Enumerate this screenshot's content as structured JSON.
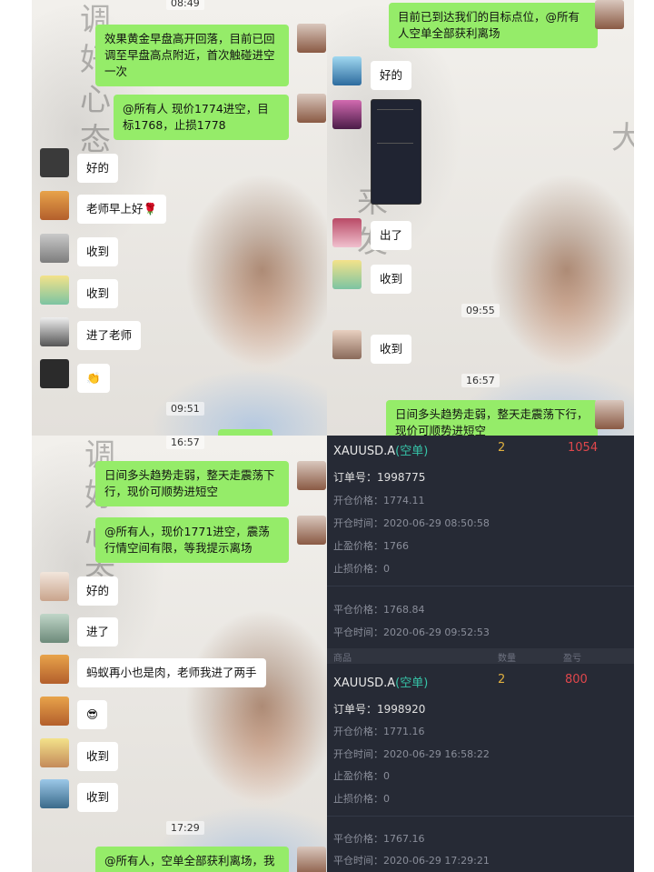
{
  "panel1": {
    "top_time": "08:49",
    "messages": [
      {
        "text": "效果黄金早盘高开回落，目前已回调至早盘高点附近，首次触碰进空一次"
      },
      {
        "text": "@所有人 现价1774进空，目标1768，止损1778"
      },
      {
        "text": "好的"
      },
      {
        "text": "老师早上好🌹"
      },
      {
        "text": "收到"
      },
      {
        "text": "收到"
      },
      {
        "text": "进了老师"
      },
      {
        "text": "👏"
      }
    ],
    "bottom_time": "09:51"
  },
  "panel2": {
    "messages": [
      {
        "text": "目前已到达我们的目标点位，@所有人空单全部获利离场"
      },
      {
        "text": "好的"
      },
      {
        "text": "出了"
      },
      {
        "text": "收到"
      },
      {
        "text": "收到"
      },
      {
        "text": "日间多头趋势走弱，整天走震荡下行，现价可顺势进短空"
      }
    ],
    "times": [
      "09:55",
      "16:57"
    ]
  },
  "panel3": {
    "top_time": "16:57",
    "messages": [
      {
        "text": "日间多头趋势走弱，整天走震荡下行，现价可顺势进短空"
      },
      {
        "text": "@所有人，现价1771进空，震荡行情空间有限，等我提示离场"
      },
      {
        "text": "好的"
      },
      {
        "text": "进了"
      },
      {
        "text": "蚂蚁再小也是肉，老师我进了两手"
      },
      {
        "text": "😎"
      },
      {
        "text": "收到"
      },
      {
        "text": "收到"
      },
      {
        "text": "@所有人，空单全部获利离场，我"
      }
    ],
    "bottom_time": "17:29"
  },
  "orders": {
    "header": {
      "col_product": "商品",
      "col_qty": "数量",
      "col_profit": "盈亏"
    },
    "items": [
      {
        "symbol": "XAUUSD.A",
        "side": "(空单)",
        "qty": "2",
        "profit": "1054",
        "order_no": "订单号：1998775",
        "open_price": "开仓价格：1774.11",
        "open_time": "开仓时间：2020-06-29 08:50:58",
        "tp": "止盈价格：1766",
        "sl": "止损价格：0",
        "close_price": "平仓价格：1768.84",
        "close_time": "平仓时间：2020-06-29 09:52:53"
      },
      {
        "symbol": "XAUUSD.A",
        "side": "(空单)",
        "qty": "2",
        "profit": "800",
        "order_no": "订单号：1998920",
        "open_price": "开仓价格：1771.16",
        "open_time": "开仓时间：2020-06-29 16:58:22",
        "tp": "止盈价格：0",
        "sl": "止损价格：0",
        "close_price": "平仓价格：1767.16",
        "close_time": "平仓时间：2020-06-29 17:29:21"
      }
    ]
  },
  "colors": {
    "green_bubble": "#95ec69",
    "dark_bg": "#262a35",
    "profit": "#e0474c",
    "side": "#36c4a8"
  }
}
